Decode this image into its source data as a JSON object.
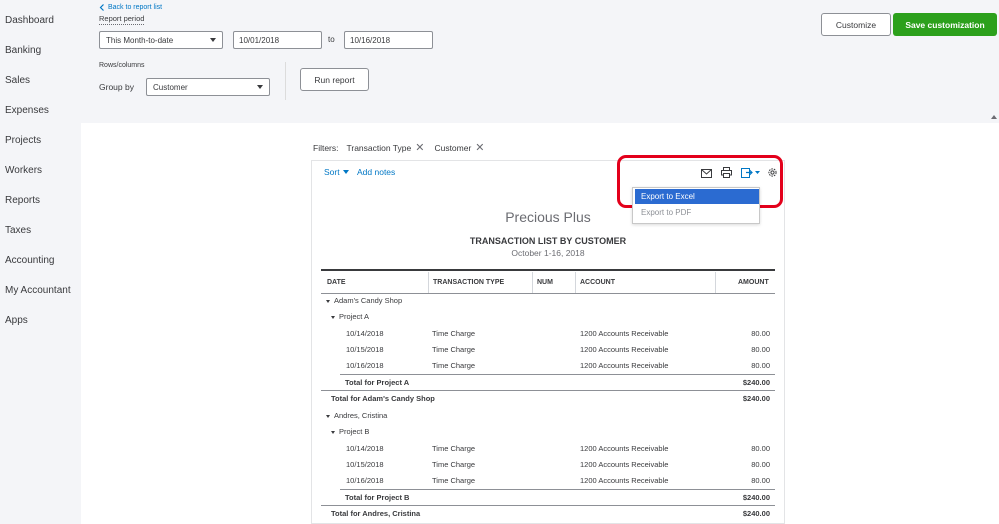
{
  "sidebar": {
    "items": [
      "Dashboard",
      "Banking",
      "Sales",
      "Expenses",
      "Projects",
      "Workers",
      "Reports",
      "Taxes",
      "Accounting",
      "My Accountant",
      "Apps"
    ]
  },
  "header": {
    "back_link": "Back to report list",
    "report_period_label": "Report period",
    "period_select": "This Month-to-date",
    "date_from": "10/01/2018",
    "to_label": "to",
    "date_to": "10/16/2018",
    "rows_columns_label": "Rows/columns",
    "group_by_label": "Group by",
    "group_by_value": "Customer",
    "run_report": "Run report",
    "customize": "Customize",
    "save_customization": "Save customization"
  },
  "filters": {
    "label": "Filters:",
    "chips": [
      "Transaction Type",
      "Customer"
    ]
  },
  "toolbar": {
    "sort": "Sort",
    "add_notes": "Add notes",
    "export_menu": [
      "Export to Excel",
      "Export to PDF"
    ]
  },
  "report": {
    "company": "Precious Plus",
    "title": "TRANSACTION LIST BY CUSTOMER",
    "dates": "October 1-16, 2018",
    "columns": [
      "DATE",
      "TRANSACTION TYPE",
      "NUM",
      "ACCOUNT",
      "AMOUNT"
    ],
    "groups": [
      {
        "customer": "Adam's Candy Shop",
        "project": "Project A",
        "rows": [
          {
            "date": "10/14/2018",
            "type": "Time Charge",
            "account": "1200 Accounts Receivable",
            "amount": "80.00"
          },
          {
            "date": "10/15/2018",
            "type": "Time Charge",
            "account": "1200 Accounts Receivable",
            "amount": "80.00"
          },
          {
            "date": "10/16/2018",
            "type": "Time Charge",
            "account": "1200 Accounts Receivable",
            "amount": "80.00"
          }
        ],
        "project_total_label": "Total for Project A",
        "project_total": "$240.00",
        "customer_total_label": "Total for Adam's Candy Shop",
        "customer_total": "$240.00"
      },
      {
        "customer": "Andres, Cristina",
        "project": "Project B",
        "rows": [
          {
            "date": "10/14/2018",
            "type": "Time Charge",
            "account": "1200 Accounts Receivable",
            "amount": "80.00"
          },
          {
            "date": "10/15/2018",
            "type": "Time Charge",
            "account": "1200 Accounts Receivable",
            "amount": "80.00"
          },
          {
            "date": "10/16/2018",
            "type": "Time Charge",
            "account": "1200 Accounts Receivable",
            "amount": "80.00"
          }
        ],
        "project_total_label": "Total for Project B",
        "project_total": "$240.00",
        "customer_total_label": "Total for Andres, Cristina",
        "customer_total": "$240.00"
      }
    ]
  },
  "colors": {
    "accent_green": "#2ca01c",
    "link_blue": "#0077c5",
    "highlight_red": "#e3001b",
    "menu_selected": "#2b6bd1"
  }
}
